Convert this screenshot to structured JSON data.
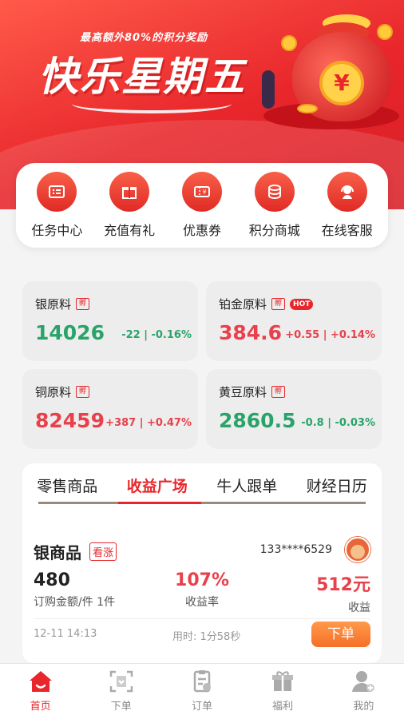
{
  "banner": {
    "subtitle": "最高额外80%的积分奖励",
    "title": "快乐星期五",
    "coin_symbol": "¥"
  },
  "nav": [
    {
      "label": "任务中心",
      "icon": "task-icon"
    },
    {
      "label": "充值有礼",
      "icon": "gift-icon"
    },
    {
      "label": "优惠券",
      "icon": "coupon-icon"
    },
    {
      "label": "积分商城",
      "icon": "points-icon"
    },
    {
      "label": "在线客服",
      "icon": "support-icon"
    }
  ],
  "market": [
    {
      "name": "银原料",
      "tag": "孵",
      "price": "14026",
      "change": "-22 | -0.16%",
      "trend": "down"
    },
    {
      "name": "铂金原料",
      "tag": "孵",
      "hot": "HOT",
      "price": "384.6",
      "change": "+0.55 | +0.14%",
      "trend": "up"
    },
    {
      "name": "铜原料",
      "tag": "孵",
      "price": "82459",
      "change": "+387 | +0.47%",
      "trend": "up"
    },
    {
      "name": "黄豆原料",
      "tag": "孵",
      "price": "2860.5",
      "change": "-0.8 | -0.03%",
      "trend": "down"
    }
  ],
  "tabs": [
    "零售商品",
    "收益广场",
    "牛人跟单",
    "财经日历"
  ],
  "active_tab": "收益广场",
  "item": {
    "name": "银商品",
    "badge": "看涨",
    "user": "133****6529",
    "amount": "480",
    "amount_label": "订购金额/件 1件",
    "rate": "107%",
    "rate_label": "收益率",
    "profit": "512元",
    "profit_label": "收益",
    "time": "12-11 14:13",
    "duration": "用时:  1分58秒",
    "order_button": "下单"
  },
  "tabbar": [
    {
      "label": "首页",
      "icon": "home-icon",
      "active": true
    },
    {
      "label": "下单",
      "icon": "scan-order-icon"
    },
    {
      "label": "订单",
      "icon": "order-list-icon"
    },
    {
      "label": "福利",
      "icon": "welfare-gift-icon"
    },
    {
      "label": "我的",
      "icon": "profile-icon"
    }
  ],
  "colors": {
    "accent": "#e8262b",
    "up": "#e8414b",
    "down": "#2aa36b",
    "order_button": "#f56f28"
  }
}
